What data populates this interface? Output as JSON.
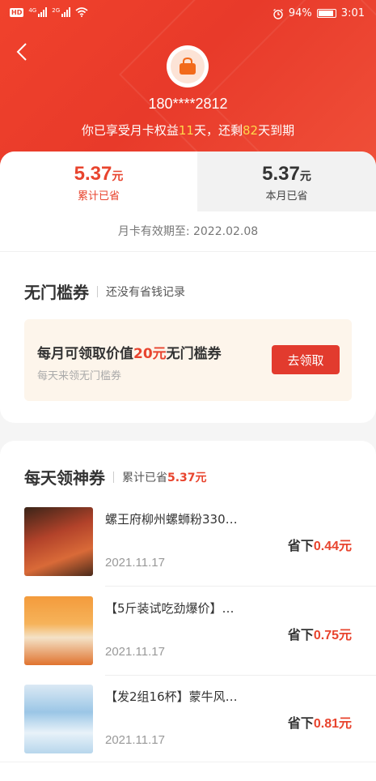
{
  "status_bar": {
    "hd_label": "HD",
    "net1": "4G",
    "net2": "2G",
    "battery_text": "94%",
    "battery_level": 0.94,
    "time": "3:01"
  },
  "header": {
    "phone": "180****2812",
    "benefit_prefix": "你已享受月卡权益",
    "benefit_days_used": "11",
    "benefit_mid": "天，还剩",
    "benefit_days_left": "82",
    "benefit_suffix": "天到期"
  },
  "savings": {
    "total_amount": "5.37",
    "total_unit": "元",
    "total_label": "累计已省",
    "month_amount": "5.37",
    "month_unit": "元",
    "month_label": "本月已省",
    "validity": "月卡有效期至: 2022.02.08"
  },
  "coupon": {
    "title": "无门槛券",
    "subtitle": "还没有省钱记录",
    "main_prefix": "每月可领取价值",
    "main_value": "20元",
    "main_suffix": "无门槛券",
    "sub": "每天来领无门槛券",
    "claim_label": "去领取"
  },
  "daily": {
    "title": "每天领神券",
    "subtitle_prefix": "累计已省",
    "subtitle_value": "5.37元",
    "items": [
      {
        "name": "螺王府柳州螺蛳粉330…",
        "date": "2021.11.17",
        "saved_prefix": "省下",
        "saved_value": "0.44元"
      },
      {
        "name": "【5斤装试吃劲爆价】…",
        "date": "2021.11.17",
        "saved_prefix": "省下",
        "saved_value": "0.75元"
      },
      {
        "name": "【发2组16杯】蒙牛风…",
        "date": "2021.11.17",
        "saved_prefix": "省下",
        "saved_value": "0.81元"
      }
    ]
  },
  "colors": {
    "brand_red": "#e8442e",
    "highlight_yellow": "#ffd84a"
  }
}
